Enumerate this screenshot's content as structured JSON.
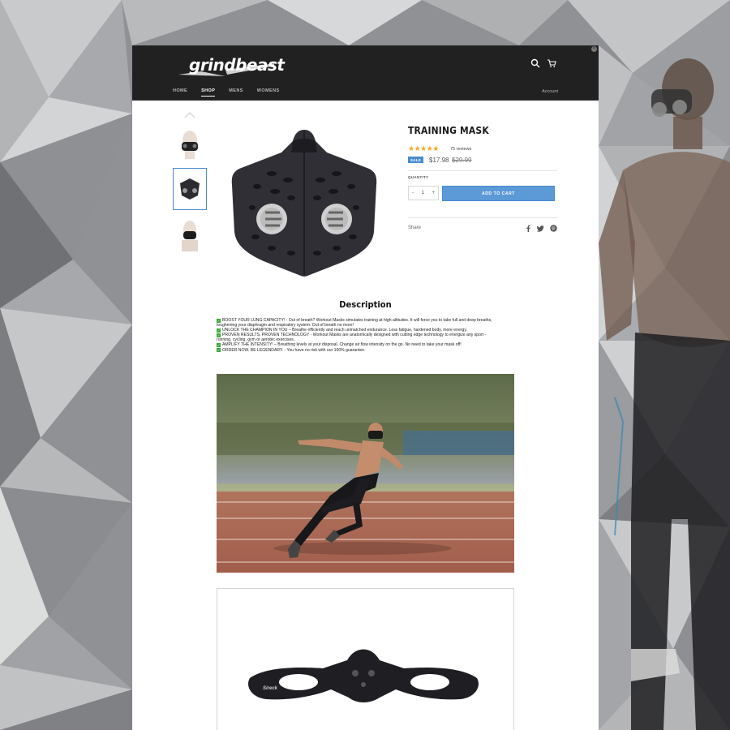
{
  "store": {
    "logo_text": "grindbeast"
  },
  "header": {
    "nav": [
      "HOME",
      "SHOP",
      "MENS",
      "WOMENS"
    ],
    "active_nav": "SHOP",
    "account_label": "Account"
  },
  "product": {
    "title": "TRAINING MASK",
    "rating_stars": 5,
    "reviews_label": "75 reviews",
    "sale_badge": "SALE",
    "price": "$17.98",
    "compare_price": "$29.99",
    "quantity_label": "QUANTITY",
    "quantity": "1",
    "add_to_cart_label": "ADD TO CART",
    "share_label": "Share",
    "accent_color": "#5b9ad6",
    "star_color": "#f5a623"
  },
  "description": {
    "heading": "Description",
    "lines": [
      "BOOST YOUR LUNG CAPACITY! - Out of breath? Workout Masks simulates training at high altitudes. It will force you to take full and deep breaths,",
      "toughening your diaphragm and respiratory system. Out of breath no more!",
      "UNLOCK THE CHAMPION IN YOU – Breathe efficiently and reach unmatched endurance. Less fatigue, hardened body, more energy.",
      "PROVEN RESULTS, PROVEN TECHNOLOGY - Workout Masks are anatomically designed with cutting edge technology to energize any sport -",
      "running, cycling, gym or aerobic exercises.",
      "AMPLIFY THE INTENSITY! – Breathing levels at your disposal. Change air flow intensity on the go. No need to take your mask off!",
      "ORDER NOW. BE LEGENDARY. - You have no risk with our 100% guarantee."
    ],
    "checked_lines": [
      0,
      2,
      3,
      5,
      6
    ]
  },
  "mask_brand_text": "Sireck",
  "icons": [
    "search-icon",
    "cart-icon",
    "chevron-up-icon",
    "facebook-icon",
    "twitter-icon",
    "pinterest-icon",
    "checkmark-icon",
    "close-icon"
  ]
}
